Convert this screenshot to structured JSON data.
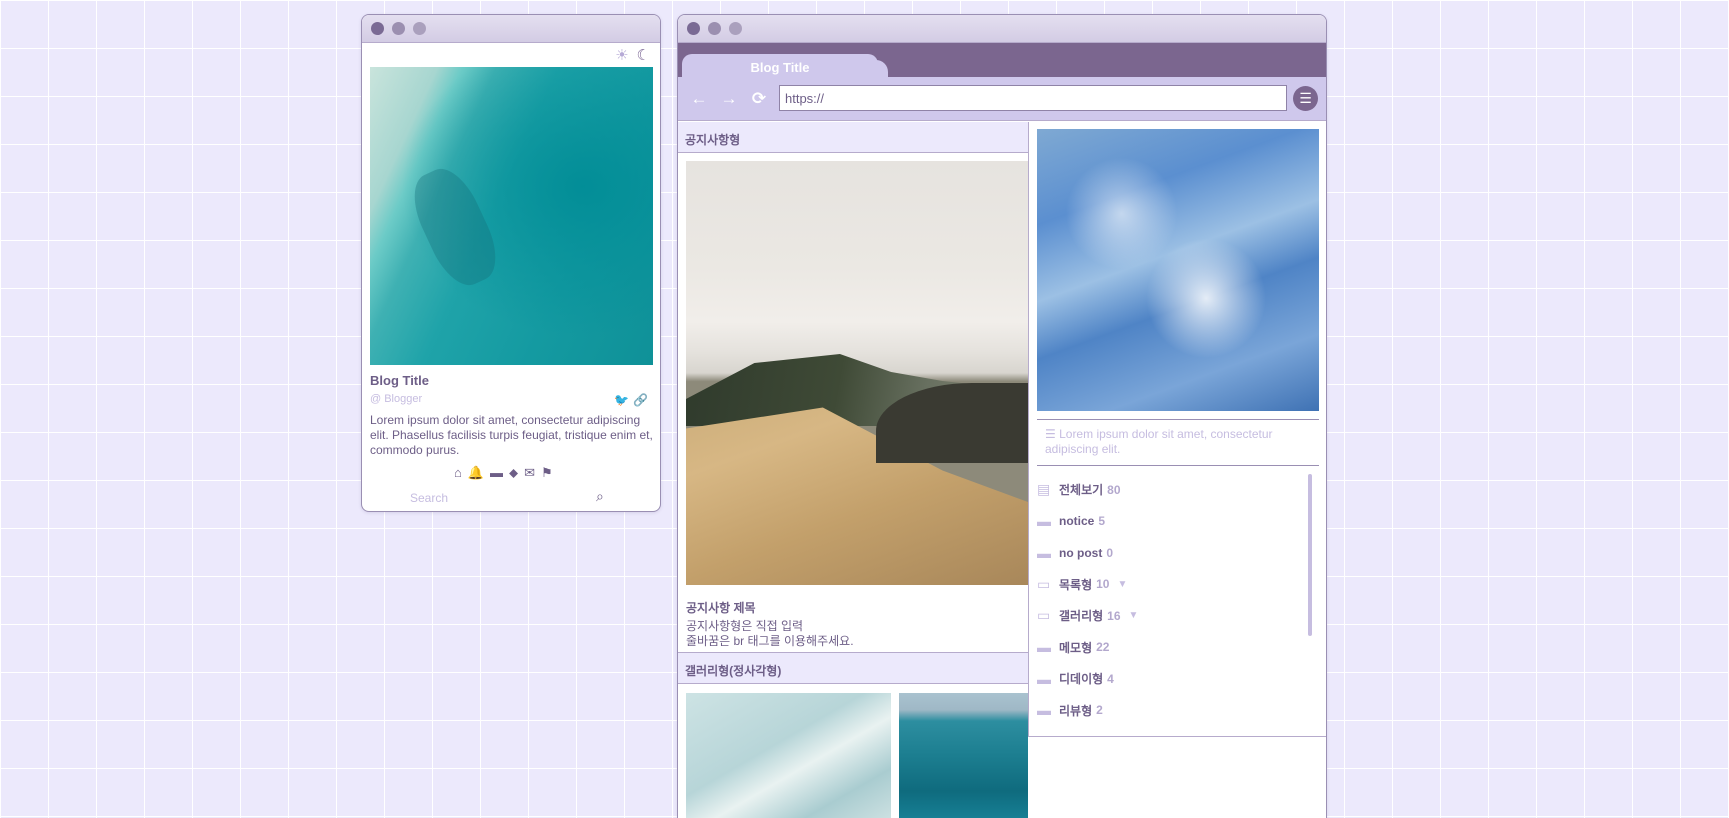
{
  "left_window": {
    "blog_title": "Blog Title",
    "blogger": "@ Blogger",
    "description": "Lorem ipsum dolor sit amet, consectetur adipiscing elit. Phasellus facilisis turpis feugiat, tristique enim et, commodo purus.",
    "search_placeholder": "Search",
    "icons": {
      "sun": "☀",
      "moon": "☾",
      "twitter": "🐦",
      "link": "🔗",
      "home": "⌂",
      "bell": "🔔",
      "folder": "▬",
      "tag": "⬥",
      "mail": "✉",
      "flag": "⚑",
      "search": "⌕"
    }
  },
  "browser": {
    "tab_title": " Blog Title",
    "url": "https://",
    "nav": {
      "back": "←",
      "forward": "→",
      "reload": "⟳",
      "menu": "☰"
    }
  },
  "main": {
    "notice_section_title": "공지사항형",
    "notice_title": "공지사항 제목",
    "notice_body_line1": "공지사항형은 직접 입력",
    "notice_body_line2": "줄바꿈은 br 태그를 이용해주세요.",
    "gallery_section_title": "갤러리형(정사각형)"
  },
  "sidebar": {
    "description": "☰ Lorem ipsum dolor sit amet, consectetur adipiscing elit.",
    "categories": [
      {
        "name": "전체보기",
        "count": "80",
        "icon": "▤",
        "caret": ""
      },
      {
        "name": "notice",
        "count": "5",
        "icon": "▬",
        "caret": ""
      },
      {
        "name": "no post",
        "count": "0",
        "icon": "▬",
        "caret": ""
      },
      {
        "name": "목록형",
        "count": "10",
        "icon": "▭",
        "caret": "▼"
      },
      {
        "name": "갤러리형",
        "count": "16",
        "icon": "▭",
        "caret": "▼"
      },
      {
        "name": "메모형",
        "count": "22",
        "icon": "▬",
        "caret": ""
      },
      {
        "name": "디데이형",
        "count": "4",
        "icon": "▬",
        "caret": ""
      },
      {
        "name": "리뷰형",
        "count": "2",
        "icon": "▬",
        "caret": ""
      }
    ]
  },
  "colors": {
    "background": "#ece9fc",
    "accent": "#7b668f",
    "text": "#6d5e87",
    "muted": "#c6bde0",
    "toolbar": "#cfc8ec"
  }
}
